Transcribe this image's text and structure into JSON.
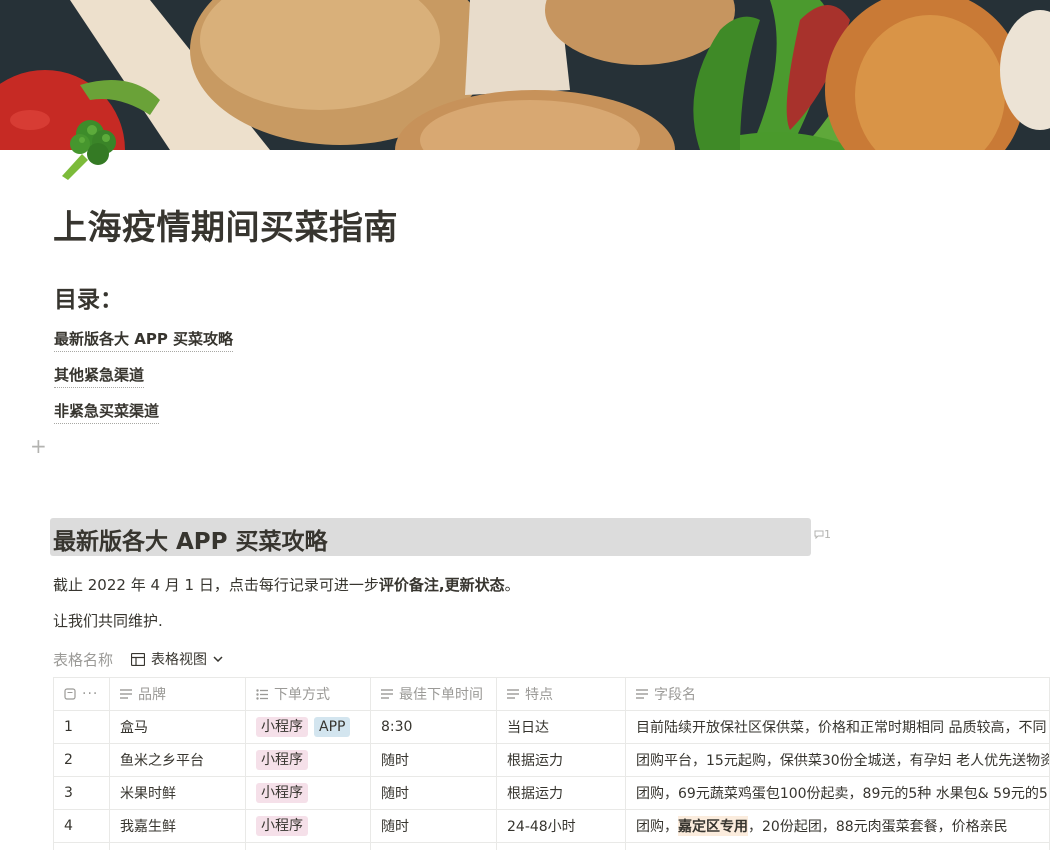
{
  "page": {
    "title": "上海疫情期间买菜指南",
    "icon": "broccoli-icon"
  },
  "toc": {
    "heading": "目录：",
    "items": [
      "最新版各大 APP 买菜攻略",
      "其他紧急渠道",
      "非紧急买菜渠道"
    ]
  },
  "section": {
    "heading": "最新版各大 APP 买菜攻略",
    "comment_count": "1",
    "para1_a": "截止 2022 年 4 月 1 日，点击每行记录可进一步",
    "para1_b": "评价备注",
    "para1_c": ",",
    "para1_d": "更新状态",
    "para1_e": "。",
    "para2": "让我们共同维护."
  },
  "database": {
    "name": "表格名称",
    "view_label": "表格视图",
    "columns": [
      "品牌",
      "下单方式",
      "最佳下单时间",
      "特点",
      "字段名"
    ],
    "header_menu": "···",
    "rows": [
      {
        "index": "1",
        "brand": "盒马",
        "tags": [
          "小程序",
          "APP"
        ],
        "time": "8:30",
        "feature": "当日达",
        "note_a": "目前陆续开放保社区保供菜，价格和正常时期相同 品质较高，不同",
        "note_hl": "",
        "note_b": ""
      },
      {
        "index": "2",
        "brand": "鱼米之乡平台",
        "tags": [
          "小程序"
        ],
        "time": "随时",
        "feature": "根据运力",
        "note_a": "团购平台，15元起购，保供菜30份全城送，有孕妇 老人优先送物资",
        "note_hl": "",
        "note_b": ""
      },
      {
        "index": "3",
        "brand": "米果时鲜",
        "tags": [
          "小程序"
        ],
        "time": "随时",
        "feature": "根据运力",
        "note_a": "团购，69元蔬菜鸡蛋包100份起卖，89元的5种 水果包& 59元的5",
        "note_hl": "",
        "note_b": ""
      },
      {
        "index": "4",
        "brand": "我嘉生鲜",
        "tags": [
          "小程序"
        ],
        "time": "随时",
        "feature": "24-48小时",
        "note_a": "团购，",
        "note_hl": "嘉定区专用",
        "note_b": "，20份起团，88元肉蛋菜套餐，价格亲民"
      }
    ]
  },
  "colors": {
    "tag_pink": "#f5e0e9",
    "tag_blue": "#d3e5ef",
    "heading_bg": "#dcdcdc",
    "highlight": "#fbecdd"
  }
}
